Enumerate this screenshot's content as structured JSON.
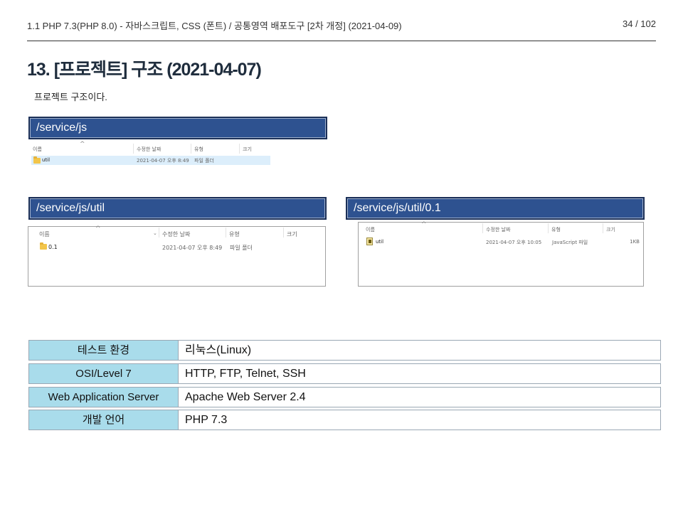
{
  "header": {
    "title": "1.1 PHP 7.3(PHP 8.0) - 자바스크립트, CSS (폰트) / 공통영역 배포도구 [2차 개정] (2021-04-09)",
    "page": "34 / 102"
  },
  "section": {
    "title": "13. [프로젝트] 구조 (2021-04-07)",
    "intro": "프로젝트 구조이다."
  },
  "panels": [
    {
      "path": "/service/js",
      "columns": [
        "이름",
        "수정한 날짜",
        "유형",
        "크기"
      ],
      "rows": [
        {
          "name": "util",
          "date": "2021-04-07 오후 8:49",
          "type": "파일 폴더",
          "size": "",
          "icon": "folder-icon"
        }
      ]
    },
    {
      "path": "/service/js/util",
      "columns": [
        "이름",
        "수정한 날짜",
        "유형",
        "크기"
      ],
      "rows": [
        {
          "name": "0.1",
          "date": "2021-04-07 오후 8:49",
          "type": "파일 폴더",
          "size": "",
          "icon": "folder-icon"
        }
      ]
    },
    {
      "path": "/service/js/util/0.1",
      "columns": [
        "이름",
        "수정한 날짜",
        "유형",
        "크기"
      ],
      "rows": [
        {
          "name": "util",
          "date": "2021-04-07 오후 10:05",
          "type": "JavaScript 파일",
          "size": "1KB",
          "icon": "javascript-file-icon"
        }
      ]
    }
  ],
  "environment": [
    {
      "key": "테스트 환경",
      "value": "리눅스(Linux)"
    },
    {
      "key": "OSI/Level 7",
      "value": "HTTP, FTP, Telnet, SSH"
    },
    {
      "key": "Web Application Server",
      "value": "Apache Web Server 2.4"
    },
    {
      "key": "개발 언어",
      "value": "PHP 7.3"
    }
  ],
  "colors": {
    "banner": "#2e5290",
    "table_key_bg": "#a9dceb",
    "title": "#1f2d3d"
  }
}
